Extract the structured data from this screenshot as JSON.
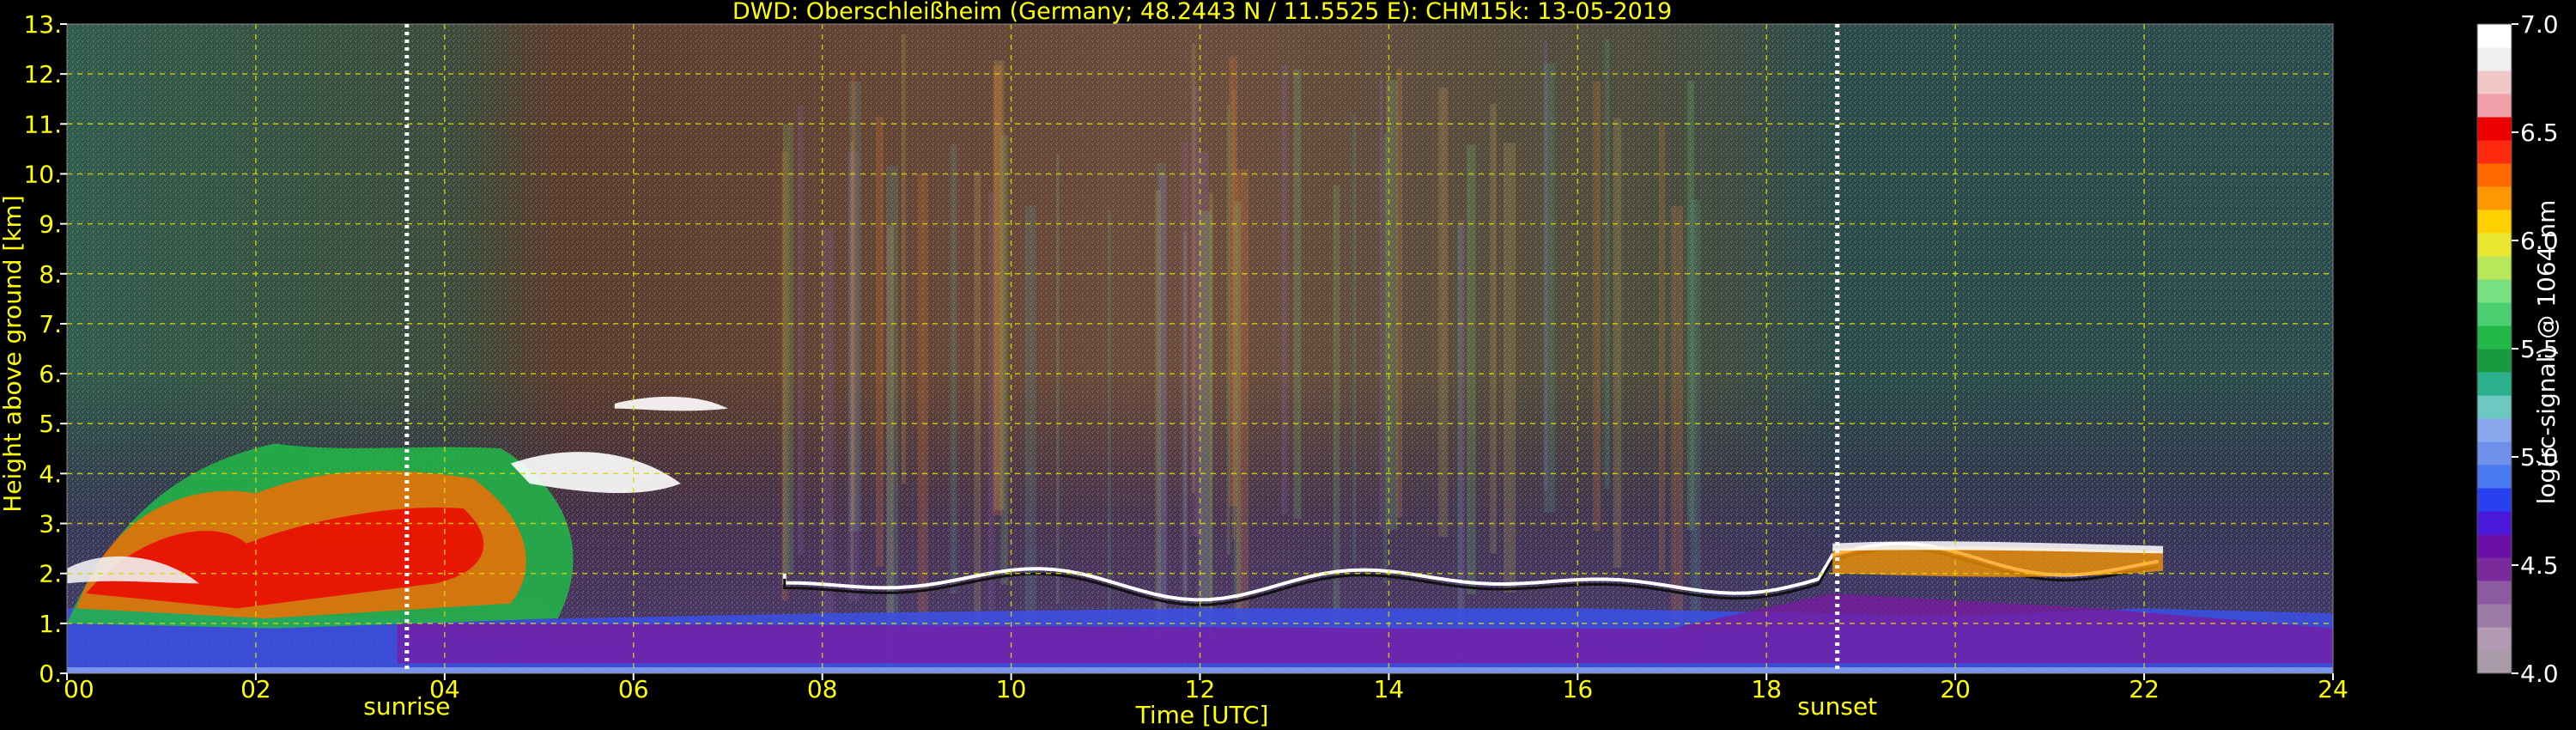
{
  "chart_data": {
    "type": "heatmap",
    "title": "DWD: Oberschleißheim (Germany; 48.2443 N / 11.5525 E):    CHM15k: 13-05-2019",
    "xlabel": "Time [UTC]",
    "ylabel": "Height above ground [km]",
    "colorbar_label": "log(rc-signal) @ 1064 nm",
    "x_ticks": [
      "00",
      "02",
      "04",
      "06",
      "08",
      "10",
      "12",
      "14",
      "16",
      "18",
      "20",
      "22",
      "24"
    ],
    "y_ticks": [
      "0.",
      "1.",
      "2.",
      "3.",
      "4.",
      "5.",
      "6.",
      "7.",
      "8.",
      "9.",
      "10.",
      "11.",
      "12.",
      "13."
    ],
    "colorbar_ticks": [
      "4.0",
      "4.5",
      "5.0",
      "5.5",
      "6.0",
      "6.5",
      "7.0"
    ],
    "xlim": [
      0,
      24
    ],
    "ylim": [
      0,
      13
    ],
    "clim": [
      4.0,
      7.0
    ],
    "grid": true,
    "markers": [
      {
        "label": "sunrise",
        "time": 3.6
      },
      {
        "label": "sunset",
        "time": 18.75
      }
    ],
    "colors": {
      "text": "#ffff00",
      "grid": "#d8d800",
      "background": "#000000",
      "colorbar_text": "#ffffff"
    },
    "colormap": [
      "#a89aa6",
      "#b29ab2",
      "#9c7aa8",
      "#8c5aa0",
      "#7a2a9a",
      "#6a10a8",
      "#4a18d8",
      "#2840f0",
      "#4a78f0",
      "#7090ec",
      "#8aa8ee",
      "#6cc8c0",
      "#2ab08c",
      "#1a9a40",
      "#22b848",
      "#4ad070",
      "#78e080",
      "#b8e85a",
      "#e8e830",
      "#ffd000",
      "#ff9800",
      "#ff6a00",
      "#ff2a10",
      "#ee0000",
      "#f0a0a8",
      "#f0c8c8",
      "#f0f0f0",
      "#ffffff"
    ]
  }
}
